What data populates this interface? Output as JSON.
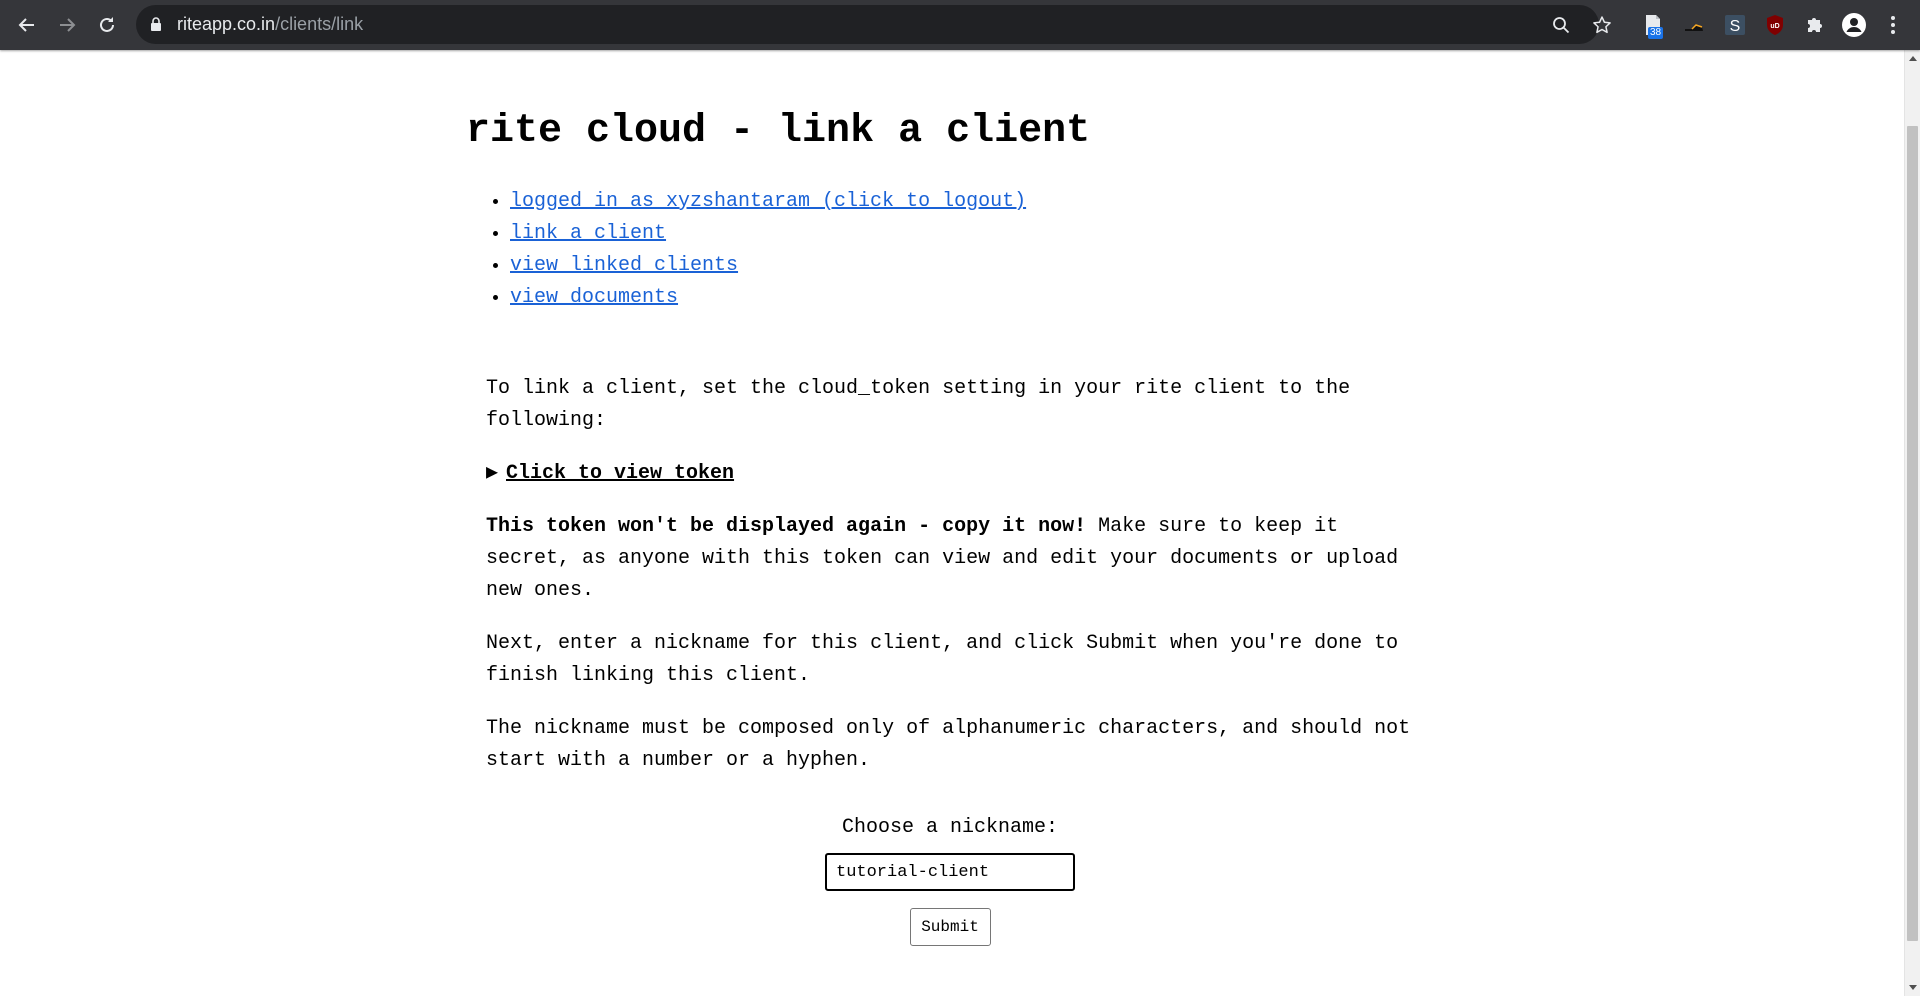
{
  "browser": {
    "url_host": "riteapp.co.in",
    "url_path": "/clients/link",
    "extension_badge": "38",
    "extension_s_label": "S",
    "ublock_label": "uD"
  },
  "page": {
    "title": "rite cloud - link a client",
    "nav": [
      {
        "label": "logged in as xyzshantaram (click to logout)"
      },
      {
        "label": "link a client"
      },
      {
        "label": "view linked clients"
      },
      {
        "label": "view documents"
      }
    ],
    "intro": "To link a client, set the cloud_token setting in your rite client to the following:",
    "token_toggle": "Click to view token",
    "warning_bold": "This token won't be displayed again - copy it now!",
    "warning_rest": " Make sure to keep it secret, as anyone with this token can view and edit your documents or upload new ones.",
    "next_step": "Next, enter a nickname for this client, and click Submit when you're done to finish linking this client.",
    "nickname_rule": "The nickname must be composed only of alphanumeric characters, and should not start with a number or a hyphen.",
    "form": {
      "label": "Choose a nickname:",
      "value": "tutorial-client",
      "submit": "Submit"
    }
  },
  "colors": {
    "toolbar": "#35363a",
    "omnibox": "#202124",
    "link": "#1a62d6"
  }
}
